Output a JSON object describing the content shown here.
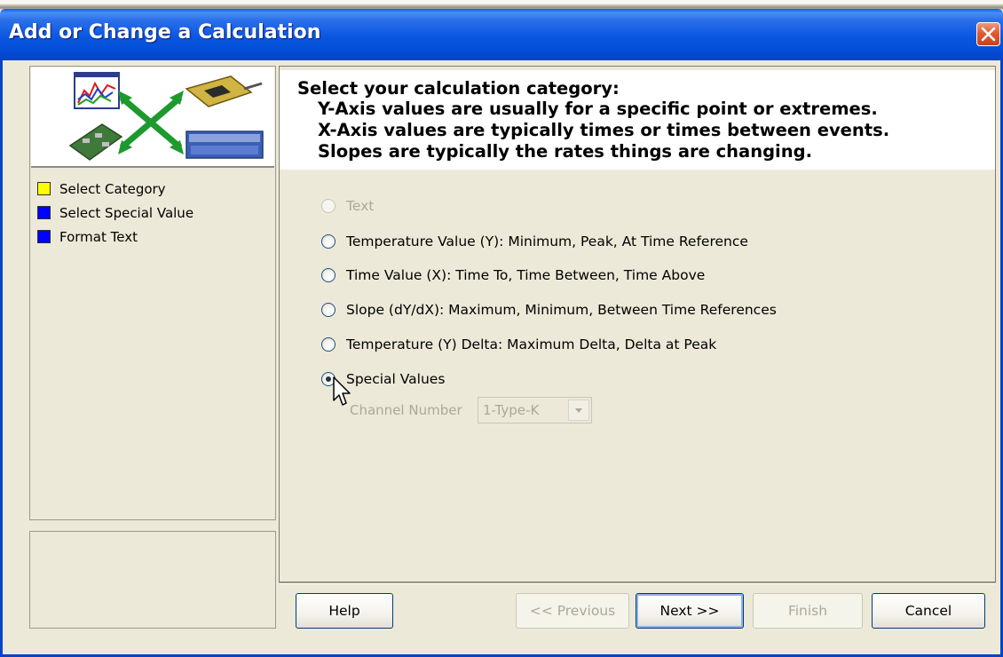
{
  "window": {
    "title": "Add or Change a Calculation"
  },
  "steps": [
    {
      "label": "Select Category",
      "color": "#ffff00"
    },
    {
      "label": "Select Special Value",
      "color": "#0000ff"
    },
    {
      "label": "Format Text",
      "color": "#0000ff"
    }
  ],
  "instructions": {
    "heading": "Select your calculation category:",
    "lines": [
      "Y-Axis values are usually for a specific point or extremes.",
      "X-Axis values are typically times or times between events.",
      "Slopes are typically the rates things are changing."
    ]
  },
  "options": [
    {
      "label": "Text",
      "enabled": false,
      "selected": false
    },
    {
      "label": "Temperature Value (Y):  Minimum, Peak, At Time Reference",
      "enabled": true,
      "selected": false
    },
    {
      "label": "Time Value (X):  Time To, Time Between, Time Above",
      "enabled": true,
      "selected": false
    },
    {
      "label": "Slope (dY/dX):  Maximum, Minimum, Between Time References",
      "enabled": true,
      "selected": false
    },
    {
      "label": "Temperature (Y) Delta:  Maximum Delta, Delta at Peak",
      "enabled": true,
      "selected": false
    },
    {
      "label": "Special  Values",
      "enabled": true,
      "selected": true
    }
  ],
  "channel": {
    "label": "Channel Number",
    "value": "1-Type-K",
    "enabled": false
  },
  "buttons": {
    "help": "Help",
    "previous": "<< Previous",
    "next": "Next >>",
    "finish": "Finish",
    "cancel": "Cancel"
  },
  "icons": {
    "graphic": "wizard-graphic",
    "close": "close-icon",
    "cursor": "mouse-cursor-icon"
  }
}
